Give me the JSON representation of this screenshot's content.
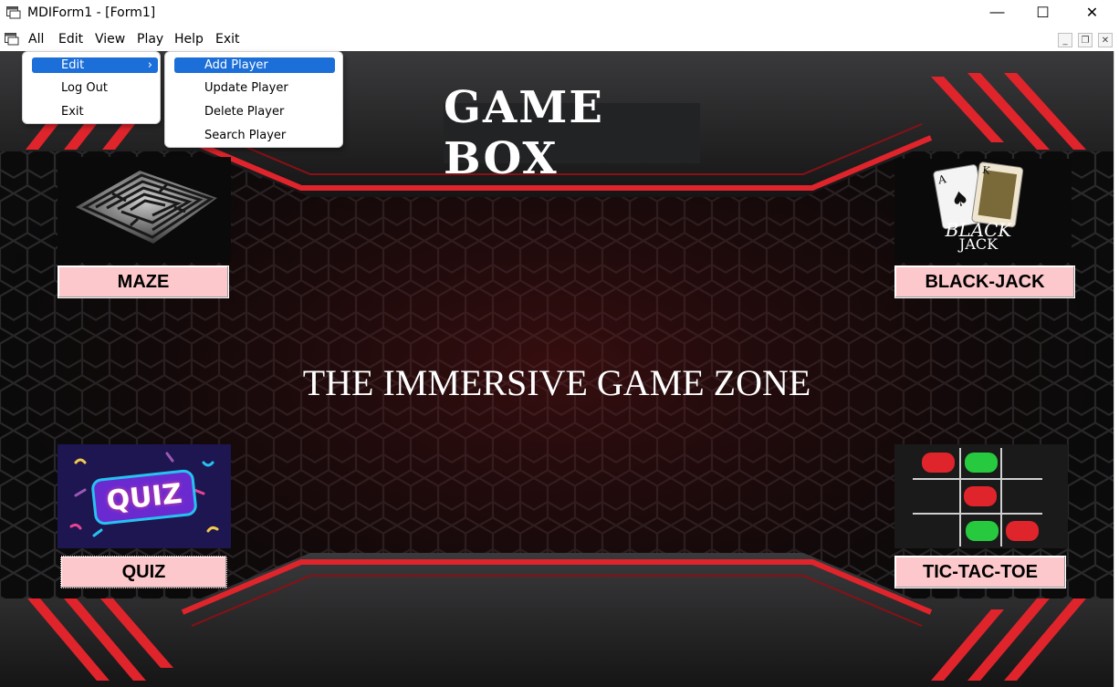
{
  "window": {
    "title": "MDIForm1 - [Form1]",
    "controls": {
      "minimize": "—",
      "maximize": "☐",
      "close": "✕"
    }
  },
  "menubar": {
    "items": [
      "All",
      "Edit",
      "View",
      "Play",
      "Help",
      "Exit"
    ],
    "mdi_controls": {
      "minimize": "_",
      "restore": "❐",
      "close": "✕"
    }
  },
  "all_menu": {
    "items": [
      {
        "label": "Edit",
        "submenu_arrow": "›",
        "highlighted": true
      },
      {
        "label": "Log Out",
        "highlighted": false
      },
      {
        "label": "Exit",
        "highlighted": false
      }
    ]
  },
  "edit_submenu": {
    "items": [
      {
        "label": "Add Player",
        "highlighted": true
      },
      {
        "label": "Update Player",
        "highlighted": false
      },
      {
        "label": "Delete Player",
        "highlighted": false
      },
      {
        "label": "Search Player",
        "highlighted": false
      }
    ]
  },
  "main": {
    "heading": "GAME BOX",
    "tagline": "THE IMMERSIVE GAME ZONE",
    "games": [
      {
        "id": "maze",
        "label": "MAZE"
      },
      {
        "id": "blackjack",
        "label": "BLACK-JACK",
        "image_text_line1": "BLACK",
        "image_text_line2": "JACK"
      },
      {
        "id": "quiz",
        "label": "QUIZ",
        "image_text": "QUIZ"
      },
      {
        "id": "tictactoe",
        "label": "TIC-TAC-TOE"
      }
    ]
  },
  "colors": {
    "accent_red": "#e0242b",
    "button_pink": "#fdc8cb",
    "menu_highlight": "#1c6fd8",
    "background": "#0b0b0c"
  }
}
